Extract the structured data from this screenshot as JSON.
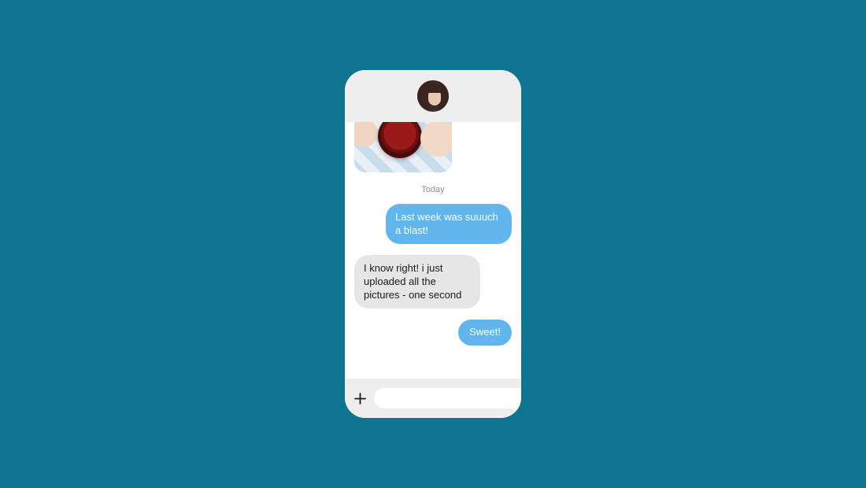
{
  "colors": {
    "page_bg": "#0e7490",
    "sent_bubble": "#60b6ed",
    "received_bubble": "#e6e6e6",
    "composer_bg": "#eeeeee"
  },
  "header": {
    "contact_avatar_desc": "woman-with-brown-hair"
  },
  "chat": {
    "date_separator": "Today",
    "messages": [
      {
        "type": "image",
        "direction": "received",
        "image_desc": "strawberries-bowl-picnic"
      },
      {
        "type": "text",
        "direction": "sent",
        "text": "Last week was suuuch a blast!"
      },
      {
        "type": "text",
        "direction": "received",
        "text": "I know right! i just uploaded all the pictures - one second"
      },
      {
        "type": "text",
        "direction": "sent",
        "text": "Sweet!"
      }
    ]
  },
  "composer": {
    "placeholder": "",
    "value": "",
    "add_icon": "plus-icon",
    "send_icon": "paper-plane-icon"
  }
}
